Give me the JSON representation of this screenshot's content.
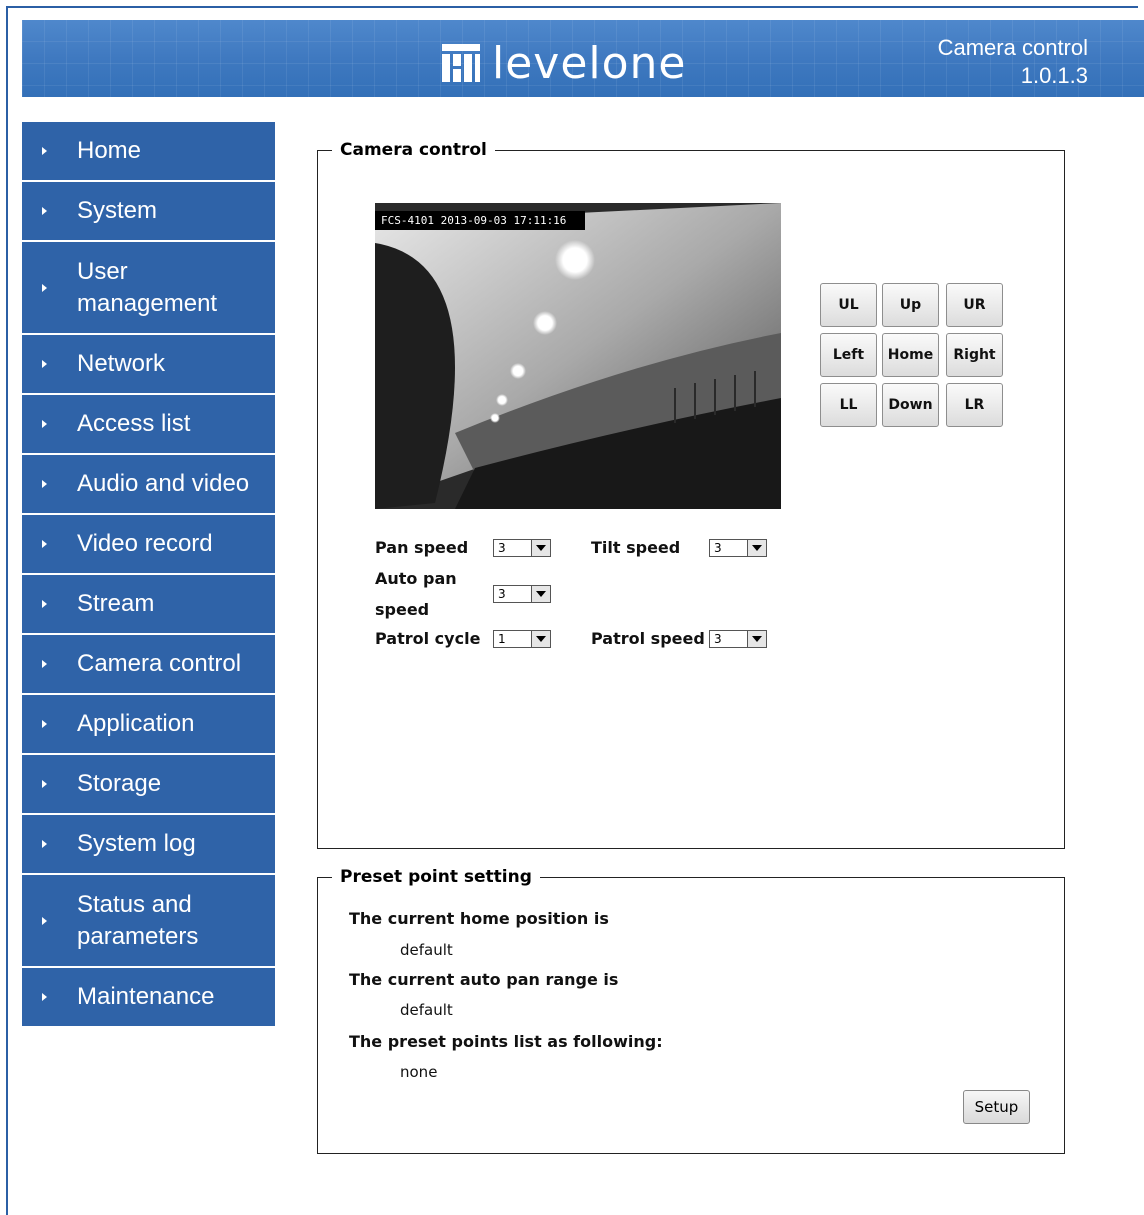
{
  "header": {
    "brand": "levelone",
    "title": "Camera control",
    "version": "1.0.1.3"
  },
  "sidebar": {
    "items": [
      {
        "label": "Home"
      },
      {
        "label": "System"
      },
      {
        "label": "User management"
      },
      {
        "label": "Network"
      },
      {
        "label": "Access list"
      },
      {
        "label": "Audio and video"
      },
      {
        "label": "Video record"
      },
      {
        "label": "Stream"
      },
      {
        "label": "Camera control"
      },
      {
        "label": "Application"
      },
      {
        "label": "Storage"
      },
      {
        "label": "System log"
      },
      {
        "label": "Status and parameters"
      },
      {
        "label": "Maintenance"
      }
    ]
  },
  "camera_control": {
    "legend": "Camera control",
    "timestamp": "FCS-4101 2013-09-03 17:11:16",
    "ptz": {
      "ul": "UL",
      "up": "Up",
      "ur": "UR",
      "left": "Left",
      "home": "Home",
      "right": "Right",
      "ll": "LL",
      "down": "Down",
      "lr": "LR"
    },
    "pan_speed": {
      "label": "Pan speed",
      "value": "3"
    },
    "tilt_speed": {
      "label": "Tilt speed",
      "value": "3"
    },
    "auto_pan_speed": {
      "label_line1": "Auto pan",
      "label_line2": "speed",
      "value": "3"
    },
    "patrol_cycle": {
      "label": "Patrol cycle",
      "value": "1"
    },
    "patrol_speed": {
      "label": "Patrol speed",
      "value": "3"
    }
  },
  "preset": {
    "legend": "Preset point setting",
    "home_label": "The current home position is",
    "home_value": "default",
    "autopan_label": "The current auto pan range is",
    "autopan_value": "default",
    "list_label": "The preset points list as following:",
    "list_value": "none",
    "setup_label": "Setup"
  }
}
